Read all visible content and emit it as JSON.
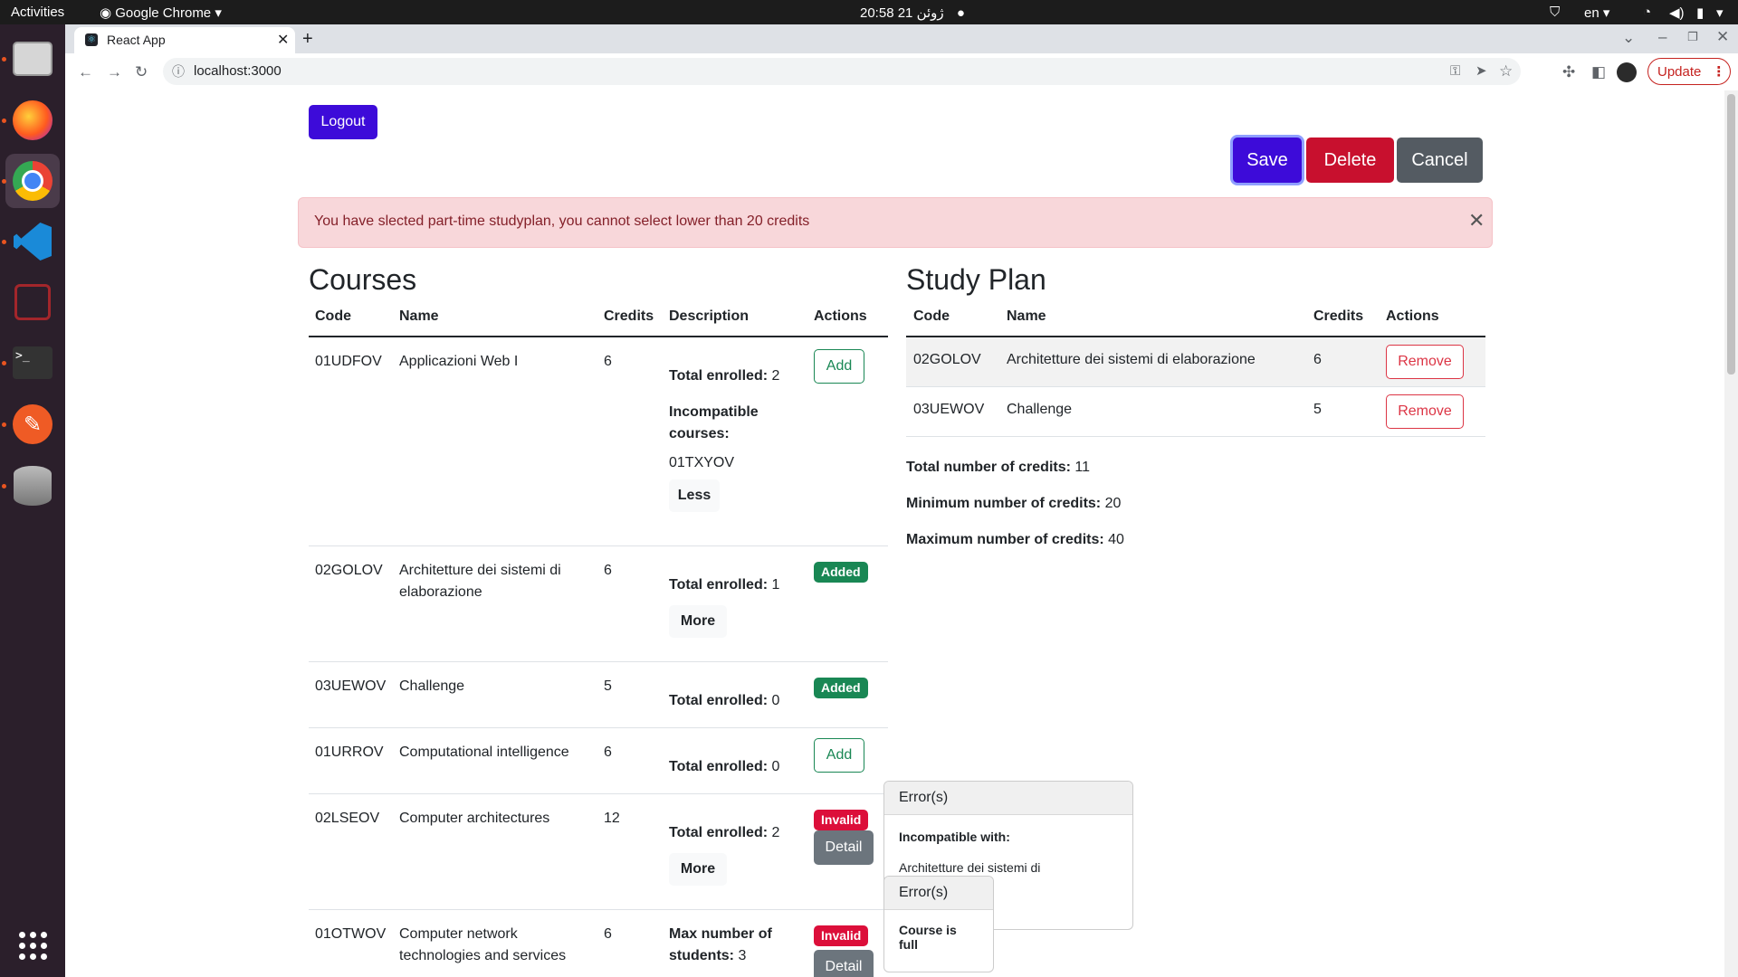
{
  "os": {
    "activities": "Activities",
    "app_menu": "Google Chrome",
    "clock": "20:58  ژوئن 21",
    "lang": "en"
  },
  "browser": {
    "tab_title": "React App",
    "url": "localhost:3000",
    "update_label": "Update"
  },
  "header": {
    "logout": "Logout",
    "save": "Save",
    "delete": "Delete",
    "cancel": "Cancel"
  },
  "colors": {
    "primary": "#3d0bd9",
    "danger": "#c8102e",
    "secondary": "#6c757d",
    "success": "#198754",
    "alert_bg": "#f8d7da"
  },
  "alert": {
    "message": "You have slected part-time studyplan, you cannot select lower than 20 credits"
  },
  "courses": {
    "title": "Courses",
    "headers": [
      "Code",
      "Name",
      "Credits",
      "Description",
      "Actions"
    ],
    "rows": [
      {
        "code": "01UDFOV",
        "name": "Applicazioni Web I",
        "credits": "6",
        "enrolled_label": "Total enrolled:",
        "enrolled": "2",
        "incompat_label": "Incompatible courses:",
        "incompat": "01TXYOV",
        "toggle": "Less",
        "action": "Add"
      },
      {
        "code": "02GOLOV",
        "name": "Architetture dei sistemi di elaborazione",
        "credits": "6",
        "enrolled_label": "Total enrolled:",
        "enrolled": "1",
        "toggle": "More",
        "action": "Added"
      },
      {
        "code": "03UEWOV",
        "name": "Challenge",
        "credits": "5",
        "enrolled_label": "Total enrolled:",
        "enrolled": "0",
        "action": "Added"
      },
      {
        "code": "01URROV",
        "name": "Computational intelligence",
        "credits": "6",
        "enrolled_label": "Total enrolled:",
        "enrolled": "0",
        "action": "Add"
      },
      {
        "code": "02LSEOV",
        "name": "Computer architectures",
        "credits": "12",
        "enrolled_label": "Total enrolled:",
        "enrolled": "2",
        "toggle": "More",
        "action": "Invalid",
        "detail": "Detail"
      },
      {
        "code": "01OTWOV",
        "name": "Computer network technologies and services",
        "credits": "6",
        "enrolled_label": "Max number of students:",
        "enrolled": "3",
        "action": "Invalid",
        "detail": "Detail"
      }
    ]
  },
  "studyplan": {
    "title": "Study Plan",
    "headers": [
      "Code",
      "Name",
      "Credits",
      "Actions"
    ],
    "rows": [
      {
        "code": "02GOLOV",
        "name": "Architetture dei sistemi di elaborazione",
        "credits": "6",
        "action": "Remove"
      },
      {
        "code": "03UEWOV",
        "name": "Challenge",
        "credits": "5",
        "action": "Remove"
      }
    ],
    "total_label": "Total number of credits:",
    "total": "11",
    "min_label": "Minimum number of credits:",
    "min": "20",
    "max_label": "Maximum number of credits:",
    "max": "40"
  },
  "popovers": [
    {
      "title": "Error(s)",
      "label": "Incompatible with:",
      "text": "Architetture dei sistemi di"
    },
    {
      "title": "Error(s)",
      "label": "Course is full"
    }
  ]
}
